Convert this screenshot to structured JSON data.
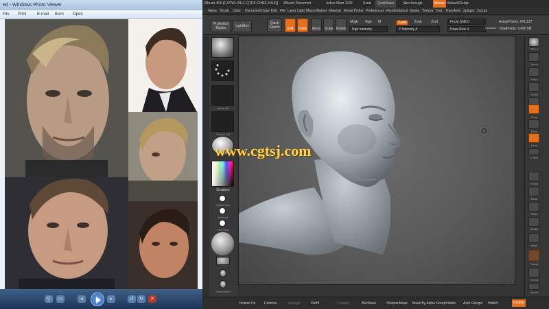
{
  "photo_viewer": {
    "title": "ed - Windows Photo Viewer",
    "menu": [
      "File",
      "Print",
      "E-mail",
      "Burn",
      "Open"
    ],
    "photo_count": 6
  },
  "zbrush": {
    "title_bar": {
      "doc_id": "ZBrush 4R6 [FJVWS-4RLF-QTDK-CHNE-HJUQ]",
      "doc_label": "ZBrush Document",
      "active_mem": "Active Mem 2239",
      "scratch": "Scrat",
      "quicksave": "QuickSave",
      "see_through": "See-through",
      "see_through_value": "0",
      "menus_label": "Menus",
      "default_script": "DefaultZScript"
    },
    "menus": [
      "Alpha",
      "Brush",
      "Color",
      "Document",
      "Draw",
      "Edit",
      "File",
      "Layer",
      "Light",
      "Macro",
      "Marker",
      "Material",
      "Movie",
      "Picker",
      "Preferences",
      "Render",
      "Stencil",
      "Stroke",
      "Texture",
      "Tool",
      "Transform",
      "Zplugin",
      "Zscript"
    ],
    "shelf": {
      "projection_master": "Projection Master",
      "lightbox": "LightBox",
      "quick_sketch": "Quick Sketch",
      "edit": "Edit",
      "draw": "Draw",
      "move": "Move",
      "scale": "Scale",
      "rotate": "Rotate",
      "mrgb": "Mrgb",
      "rgb": "Rgb",
      "m": "M",
      "rgb_intensity": "Rgb Intensity",
      "zadd": "Zadd",
      "zsub": "Zsub",
      "zcut": "Zcut",
      "z_intensity_label": "Z Intensity",
      "z_intensity_value": "8",
      "focal_shift_label": "Focal Shift",
      "focal_shift_value": "0",
      "draw_size_label": "Draw Size",
      "draw_size_value": "4",
      "dynamic": "Dynamic",
      "active_points": "ActivePoints: 241,137",
      "total_points": "TotalPoints: 3.490 Mil"
    },
    "left_tray": {
      "labels": [
        "",
        "",
        "Alpha Off",
        "Texture Off",
        "Gradient",
        "SwitchColor",
        "Alternate",
        "Flat Color",
        "",
        "",
        "Transparent"
      ],
      "gradient": "Gradient"
    },
    "right_tray": {
      "labels": [
        "SPix 3",
        "Scroll",
        "Zoom",
        "Actual",
        "AAHalf",
        "Persp",
        "Floor",
        "Local",
        "L.Sym",
        "Frame",
        "Move",
        "Scale",
        "Rotate",
        "PolyF",
        "Transp",
        "Ghost",
        "Solo",
        "Xpose"
      ]
    },
    "bottom_bar": [
      "Texture On",
      "Colorize",
      "Strength",
      "DelHi",
      "Unstack",
      "BlurMask",
      "SharpenMask",
      "Mask By Alpha GroupVisible",
      "Auto Groups",
      "HidePt",
      "Double"
    ]
  },
  "watermark": "www.cgtsj.com",
  "colors": {
    "zbrush_accent": "#e3701f",
    "zbrush_bg": "#353535",
    "watermark": "#ffd24a"
  }
}
